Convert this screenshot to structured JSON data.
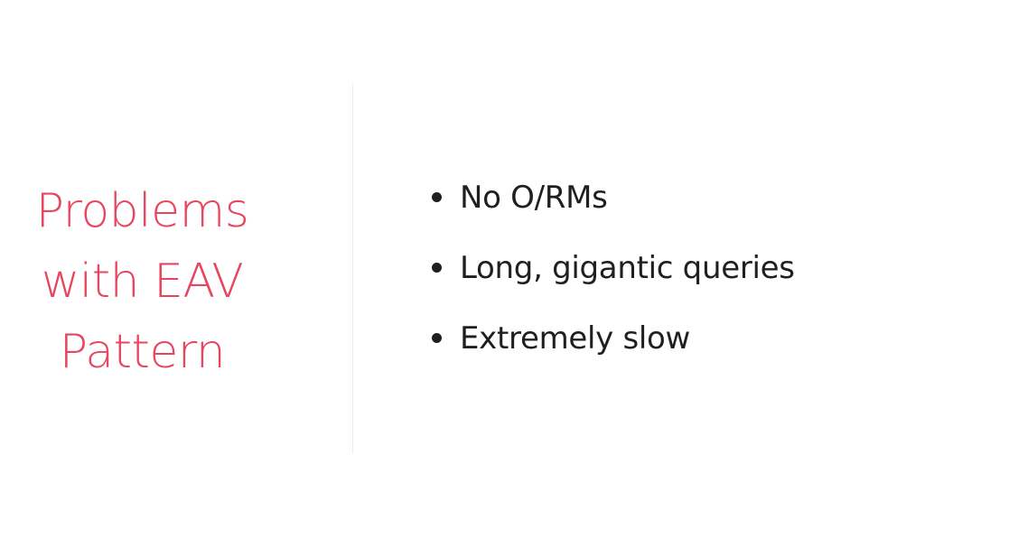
{
  "slide": {
    "title_lines": [
      "Problems",
      "with EAV",
      "Pattern"
    ],
    "bullets": [
      "No O/RMs",
      "Long, gigantic queries",
      "Extremely slow"
    ]
  },
  "colors": {
    "title": "#e8455f",
    "body_text": "#1f1f1f",
    "divider": "#ececec",
    "background": "#ffffff"
  }
}
